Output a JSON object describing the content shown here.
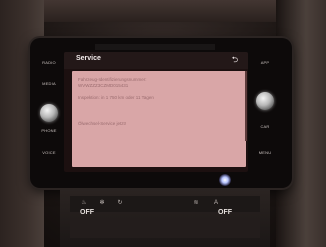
{
  "screen": {
    "title": "Service",
    "back_icon": "back-arrow-icon",
    "lines": [
      "Fahrzeug-Identifizierungsnummer:",
      "WVWZZZ3CZMD015431",
      "Inspektion: in 1 750 km oder 11 Tagen",
      "Ölwechsel-Service jetzt!"
    ]
  },
  "hardware": {
    "left_labels": [
      "RADIO",
      "MEDIA",
      "PHONE",
      "VOICE"
    ],
    "right_labels": [
      "APP",
      "CAR",
      "MENU"
    ]
  },
  "climate": {
    "left_off": "OFF",
    "right_off": "OFF"
  }
}
